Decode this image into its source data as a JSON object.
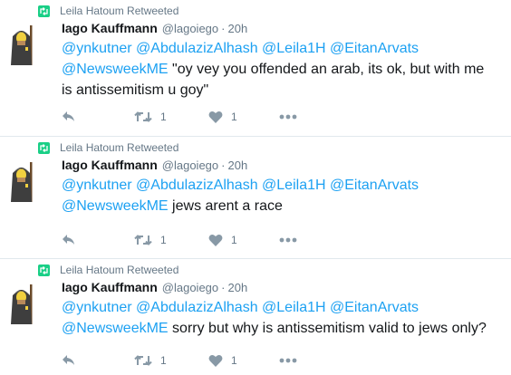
{
  "colors": {
    "accent": "#1da1f2",
    "retweet": "#19cf86",
    "muted": "#657786"
  },
  "tweets": [
    {
      "retweeted_by": "Leila Hatoum Retweeted",
      "name": "Iago Kauffmann",
      "handle": "@lagoiego",
      "separator": "·",
      "time": "20h",
      "mentions_line1": "@ynkutner @AbdulazizAlhash @Leila1H @EitanArvats",
      "mentions_line2": "@NewsweekME",
      "text": " \"oy vey you offended an arab, its ok, but with me is antissemitism u goy\"",
      "retweet_count": "1",
      "like_count": "1"
    },
    {
      "retweeted_by": "Leila Hatoum Retweeted",
      "name": "Iago Kauffmann",
      "handle": "@lagoiego",
      "separator": "·",
      "time": "20h",
      "mentions_line1": "@ynkutner @AbdulazizAlhash @Leila1H @EitanArvats",
      "mentions_line2": "@NewsweekME",
      "text": " jews arent a race",
      "retweet_count": "1",
      "like_count": "1"
    },
    {
      "retweeted_by": "Leila Hatoum Retweeted",
      "name": "Iago Kauffmann",
      "handle": "@lagoiego",
      "separator": "·",
      "time": "20h",
      "mentions_line1": "@ynkutner @AbdulazizAlhash @Leila1H @EitanArvats",
      "mentions_line2": "@NewsweekME",
      "text": " sorry but why is antissemitism valid to jews only?",
      "retweet_count": "1",
      "like_count": "1"
    }
  ]
}
